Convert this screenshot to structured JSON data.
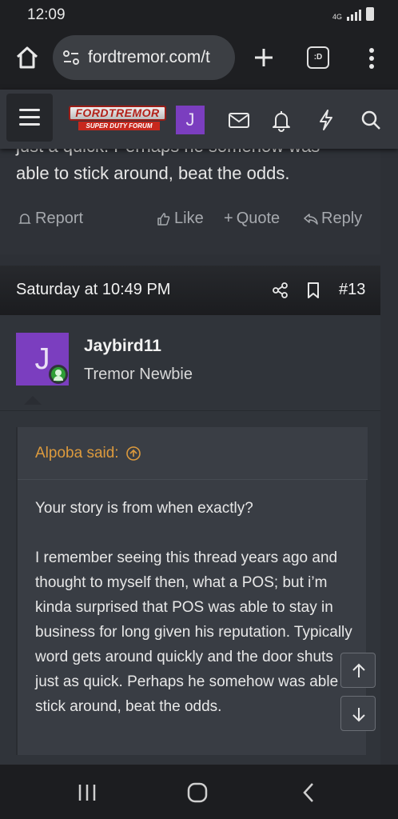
{
  "status_bar": {
    "time": "12:09",
    "network_label": "4G",
    "icons": [
      "signal-icon",
      "battery-icon"
    ]
  },
  "browser": {
    "url": "fordtremor.com/t",
    "tabs_label": ":D"
  },
  "site_header": {
    "logo_text": "FORDTREMOR",
    "logo_subtitle": "SUPER DUTY FORUM",
    "avatar_letter": "J",
    "icons": [
      "menu-icon",
      "mail-icon",
      "bell-icon",
      "bolt-icon",
      "search-icon"
    ]
  },
  "previous_post": {
    "text_cut": "just a quick. Perhaps he somehow was",
    "text_last": "able to stick around, beat the odds.",
    "actions": {
      "report": "Report",
      "like": "Like",
      "quote": "Quote",
      "reply": "Reply"
    }
  },
  "post": {
    "date": "Saturday at 10:49 PM",
    "number": "#13",
    "author": {
      "avatar_letter": "J",
      "name": "Jaybird11",
      "title": "Tremor Newbie",
      "online": true
    },
    "quote": {
      "author": "Alpoba said:",
      "paragraphs": [
        "Your story is from when exactly?",
        "I remember seeing this thread years ago and thought to myself then, what a POS; but i’m kinda surprised that POS was able to stay in business for long given his reputation. Typically word gets around quickly and the door shuts just as quick. Perhaps he somehow was able to stick around, beat the odds."
      ]
    }
  },
  "colors": {
    "accent_purple": "#7b3ebf",
    "quote_author": "#dc9a3d",
    "online_green": "#2e9e36"
  }
}
